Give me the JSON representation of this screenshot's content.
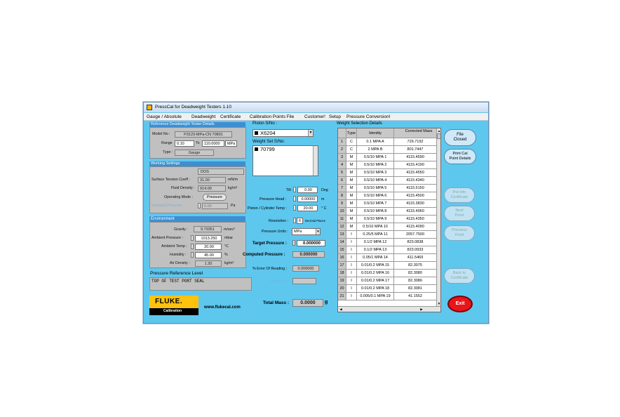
{
  "window": {
    "title": "PressCal for Deadweight Testers 1.10"
  },
  "menu": [
    "Gauge / Absolute",
    "Deadweight",
    "Certificate",
    "Calibration Points File",
    "Customer!",
    "Setup",
    "Pressure Conversion!"
  ],
  "reference": {
    "title": "Reference Deadweight Tester Details",
    "model_label": "Model No :",
    "model_value": "P3123-MPa-CN 70801",
    "range_label": "Range",
    "range_from": "0.10",
    "range_to_label": "To",
    "range_to": "110.0000",
    "range_unit": "MPa",
    "type_label": "Type :",
    "type_value": "Gauge"
  },
  "working": {
    "title": "Working Settings",
    "fluid_name": "DOS",
    "surface_label": "Surface Tension Coeff :",
    "surface_value": "31.00",
    "surface_unit": "mN/m",
    "density_label": "Fluid Density :",
    "density_value": "914.00",
    "density_unit": "kg/m³",
    "mode_label": "Operating Mode :",
    "mode_value": "Pressure",
    "residual_label": "Residual Pressure :",
    "residual_value": "0.00",
    "residual_unit": "Pa"
  },
  "environment": {
    "title": "Environment",
    "gravity_label": "Gravity :",
    "gravity_value": "9.79351",
    "gravity_unit": "m/sec²",
    "ambient_label": "Ambient Pressure :",
    "ambient_value": "1013.250",
    "ambient_unit": "mbar",
    "temp_label": "Ambient Temp :",
    "temp_value": "20.00",
    "temp_unit": "°C",
    "humidity_label": "Humidity :",
    "humidity_value": "45.00",
    "humidity_unit": "%",
    "air_label": "Air Density :",
    "air_value": "1.20",
    "air_unit": "kg/m³"
  },
  "pressure_ref": {
    "title": "Pressure Reference Level",
    "value": "TOP OF TEST PORT SEAL"
  },
  "brand": {
    "logo": "FLUKE.",
    "sub": "Calibration",
    "url": "www.flukecal.com"
  },
  "piston": {
    "label": "Piston S/No :",
    "value": "X6204"
  },
  "weightset": {
    "label": "Weight Set S/No:",
    "value": "70799"
  },
  "middle": {
    "tilt_label": "Tilt :",
    "tilt_value": "0.00",
    "tilt_unit": "Deg",
    "head_label": "Pressure Head :",
    "head_value": "0.00000",
    "head_unit": "m",
    "piston_temp_label": "Piston / Cylinder Temp :",
    "piston_temp_value": "20.00",
    "piston_temp_unit": "° C",
    "resolution_label": "Resolution :",
    "resolution_value": "6",
    "resolution_unit": "Decimal Places",
    "units_label": "Pressure Units :",
    "units_value": "MPa",
    "target_label": "Target Pressure :",
    "target_value": "0.000000",
    "computed_label": "Computed Pressure :",
    "computed_value": "0.000000",
    "error_label": "% Error Of Reading :",
    "error_value": "0.000000",
    "passfail_label": "Pass / Fail :",
    "passfail_value": "",
    "mass_label": "Total Mass :",
    "mass_value": "0.0000",
    "mass_unit": "g"
  },
  "weights": {
    "title": "Weight Selection Details",
    "headers": [
      "",
      "Type",
      "Identity",
      "Corrected Mass"
    ],
    "rows": [
      [
        "1",
        "C",
        "0.1 MPA A",
        "729.7192"
      ],
      [
        "2",
        "C",
        "2 MPA B",
        "801.7447"
      ],
      [
        "3",
        "M",
        "0.5/10 MPA 1",
        "4115.4590"
      ],
      [
        "4",
        "M",
        "0.5/10 MPA 2",
        "4115.4190"
      ],
      [
        "5",
        "M",
        "0.5/10 MPA 3",
        "4115.4550"
      ],
      [
        "6",
        "M",
        "0.5/10 MPA 4",
        "4115.4340"
      ],
      [
        "7",
        "M",
        "0.5/10 MPA 5",
        "4115.5150"
      ],
      [
        "8",
        "M",
        "0.5/10 MPA 6",
        "4115.4500"
      ],
      [
        "9",
        "M",
        "0.5/10 MPA 7",
        "4115.3830"
      ],
      [
        "10",
        "M",
        "0.5/10 MPA 8",
        "4115.4960"
      ],
      [
        "11",
        "M",
        "0.5/10 MPA 9",
        "4115.4350"
      ],
      [
        "12",
        "M",
        "0.5/10 MPA 10",
        "4115.4090"
      ],
      [
        "13",
        "I",
        "0.25/5 MPA 11",
        "2057.7500"
      ],
      [
        "14",
        "I",
        "0.1/2 MPA 12",
        "823.0838"
      ],
      [
        "15",
        "I",
        "0.1/2 MPA 13",
        "823.0933"
      ],
      [
        "16",
        "I",
        "0.05/1 MPA 14",
        "411.5469"
      ],
      [
        "17",
        "I",
        "0.01/0.2 MPA 15",
        "82.3075"
      ],
      [
        "18",
        "I",
        "0.01/0.2 MPA 16",
        "82.3080"
      ],
      [
        "19",
        "I",
        "0.01/0.2 MPA 17",
        "82.3086"
      ],
      [
        "20",
        "I",
        "0.01/0.2 MPA 18",
        "82.3081"
      ],
      [
        "21",
        "I",
        "0.005/0.1 MPA 19",
        "41.1552"
      ]
    ]
  },
  "buttons": {
    "file_closed": [
      "File",
      "Closed"
    ],
    "print_cal": [
      "Print Cal",
      "Point Details"
    ],
    "put_into": [
      "Put into",
      "Certificate"
    ],
    "next": [
      "Next",
      "Point"
    ],
    "previous": [
      "Previous",
      "Point"
    ],
    "back": [
      "Back to",
      "Certificate"
    ],
    "exit": "Exit"
  },
  "colors": {
    "window_bg": "#5ec7ee",
    "section_bar": "#3d8fd1",
    "exit_red": "#e8151b",
    "fluke_yellow": "#ffc20e"
  }
}
